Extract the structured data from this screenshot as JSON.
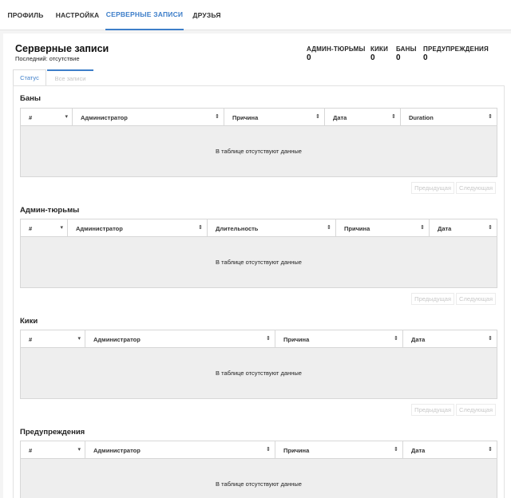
{
  "nav": {
    "tabs": [
      {
        "label": "ПРОФИЛЬ"
      },
      {
        "label": "НАСТРОЙКА"
      },
      {
        "label": "СЕРВЕРНЫЕ ЗАПИСИ"
      },
      {
        "label": "ДРУЗЬЯ"
      }
    ],
    "active": "СЕРВЕРНЫЕ ЗАПИСИ"
  },
  "header": {
    "title": "Серверные записи",
    "subtitle": "Последний: отсутствие"
  },
  "stats": [
    {
      "label": "АДМИН-ТЮРЬМЫ",
      "value": "0"
    },
    {
      "label": "КИКИ",
      "value": "0"
    },
    {
      "label": "БАНЫ",
      "value": "0"
    },
    {
      "label": "ПРЕДУПРЕЖДЕНИЯ",
      "value": "0"
    }
  ],
  "subtabs": [
    {
      "label": "Статус"
    },
    {
      "label": "Все записи"
    }
  ],
  "empty_text": "В таблице отсутствуют данные",
  "pager": {
    "prev": "Предыдущая",
    "next": "Следующая"
  },
  "sections": [
    {
      "title": "Баны",
      "columns": [
        "#",
        "Администратор",
        "Причина",
        "Дата",
        "Duration"
      ]
    },
    {
      "title": "Админ-тюрьмы",
      "columns": [
        "#",
        "Администратор",
        "Длительность",
        "Причина",
        "Дата"
      ]
    },
    {
      "title": "Кики",
      "columns": [
        "#",
        "Администратор",
        "Причина",
        "Дата"
      ]
    },
    {
      "title": "Предупреждения",
      "columns": [
        "#",
        "Администратор",
        "Причина",
        "Дата"
      ]
    }
  ],
  "colors": {
    "accent": "#3d7ec9",
    "empty_row_bg": "#eeeeee",
    "border": "#d7d7d7"
  }
}
